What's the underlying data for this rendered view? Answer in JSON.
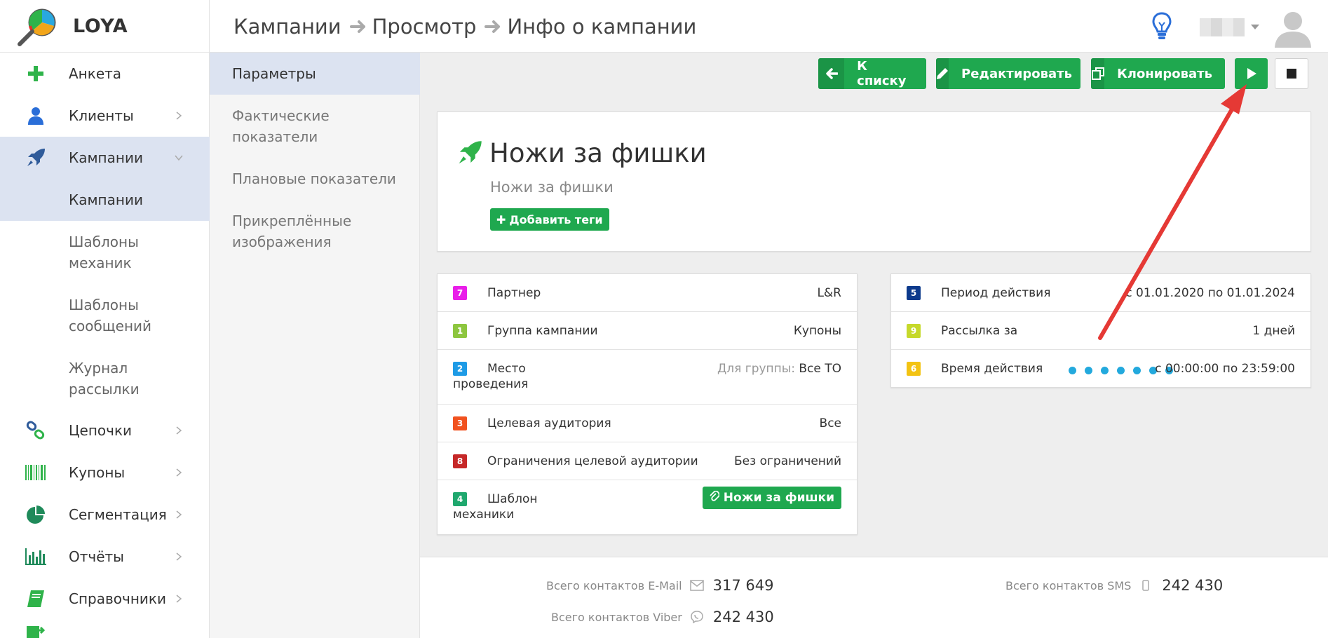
{
  "app": {
    "name": "LOYA"
  },
  "breadcrumb": [
    "Кампании",
    "Просмотр",
    "Инфо о кампании"
  ],
  "sidebar": {
    "items": [
      {
        "label": "Анкета",
        "icon": "plus-icon"
      },
      {
        "label": "Клиенты",
        "icon": "user-icon"
      },
      {
        "label": "Кампании",
        "icon": "rocket-icon"
      },
      {
        "label": "Цепочки",
        "icon": "link-icon"
      },
      {
        "label": "Купоны",
        "icon": "barcode-icon"
      },
      {
        "label": "Сегментация",
        "icon": "pie-chart-icon"
      },
      {
        "label": "Отчёты",
        "icon": "bar-chart-icon"
      },
      {
        "label": "Справочники",
        "icon": "book-icon"
      }
    ],
    "sub_items": [
      "Кампании",
      "Шаблоны механик",
      "Шаблоны сообщений",
      "Журнал рассылки"
    ]
  },
  "subnav": {
    "items": [
      "Параметры",
      "Фактические показатели",
      "Плановые показатели",
      "Прикреплённые изображения"
    ]
  },
  "toolbar": {
    "back_label": "К списку",
    "edit_label": "Редактировать",
    "clone_label": "Клонировать"
  },
  "campaign": {
    "title": "Ножи за фишки",
    "subtitle": "Ножи за фишки",
    "add_tags_label": "Добавить теги"
  },
  "left_rows": [
    {
      "badge": "7",
      "color": "#e91ee9",
      "label": "Партнер",
      "value": "L&R"
    },
    {
      "badge": "1",
      "color": "#8dc63f",
      "label": "Группа кампании",
      "value": "Купоны"
    },
    {
      "badge": "2",
      "color": "#1e9be6",
      "label": "Место проведения",
      "prefix": "Для группы:",
      "value": "Все ТО"
    },
    {
      "badge": "3",
      "color": "#f1521f",
      "label": "Целевая аудитория",
      "value": "Все"
    },
    {
      "badge": "8",
      "color": "#c62828",
      "label": "Ограничения целевой аудитории",
      "value": "Без ограничений"
    },
    {
      "badge": "4",
      "color": "#1fa86e",
      "label": "Шаблон механики",
      "value": "Ножи за фишки"
    }
  ],
  "right_rows": [
    {
      "badge": "5",
      "color": "#0d3a8c",
      "label": "Период действия",
      "value": "с 01.01.2020 по 01.01.2024"
    },
    {
      "badge": "9",
      "color": "#c6d92b",
      "label": "Рассылка за",
      "value": "1 дней"
    },
    {
      "badge": "6",
      "color": "#f3c312",
      "label": "Время действия",
      "value": "с 00:00:00 по 23:59:00"
    }
  ],
  "stats": [
    {
      "label": "Всего контактов E-Mail",
      "icon": "envelope-icon",
      "value": "317 649"
    },
    {
      "label": "Всего контактов SMS",
      "icon": "phone-icon",
      "value": "242 430"
    },
    {
      "label": "Всего контактов Viber",
      "icon": "viber-icon",
      "value": "242 430"
    }
  ],
  "colors": {
    "accent_green": "#1fa84f",
    "active_bg": "#dce3f1",
    "annotation_red": "#e53935"
  }
}
